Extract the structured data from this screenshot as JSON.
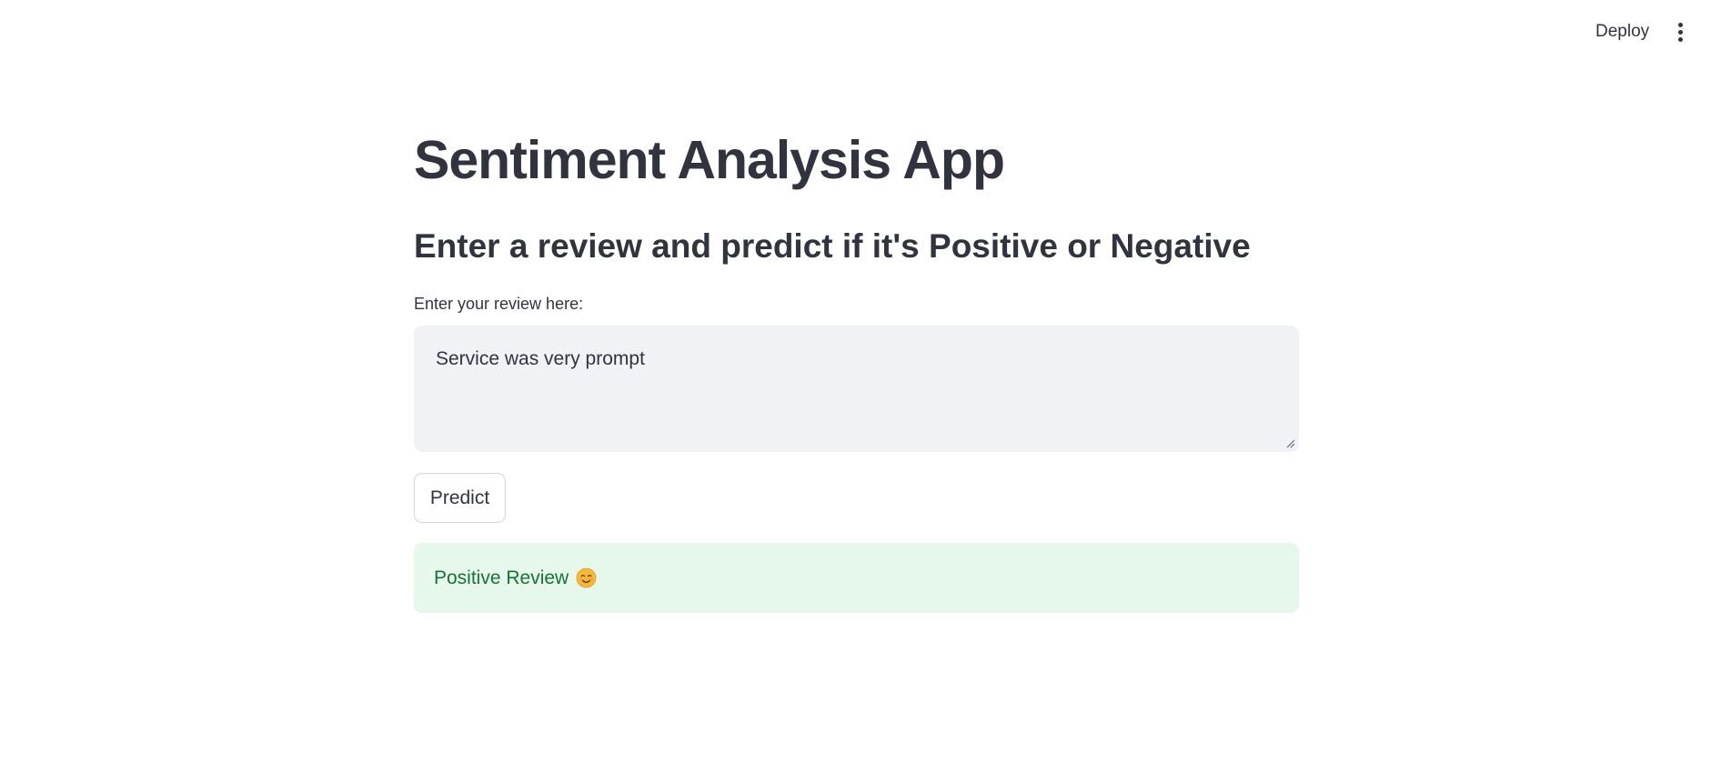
{
  "header": {
    "deploy_label": "Deploy",
    "menu_icon": "kebab-menu-icon"
  },
  "main": {
    "title": "Sentiment Analysis App",
    "subtitle": "Enter a review and predict if it's Positive or Negative",
    "review_field": {
      "label": "Enter your review here:",
      "value": "Service was very prompt"
    },
    "predict_label": "Predict",
    "result": {
      "text": "Positive Review",
      "emoji_icon": "smiling-face-icon",
      "status": "success"
    }
  },
  "colors": {
    "text": "#31333f",
    "input_bg": "#f0f2f6",
    "success_bg": "#e6f8ec",
    "success_text": "#177233"
  }
}
